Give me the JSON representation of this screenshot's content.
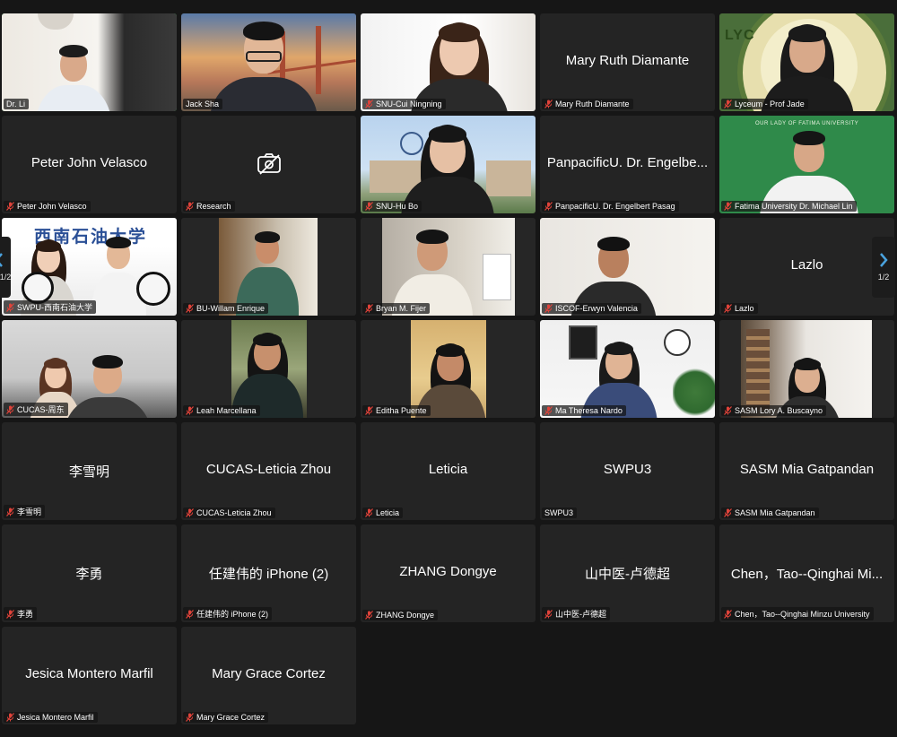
{
  "meeting": {
    "page_indicator": "1/2",
    "participants": [
      {
        "id": "dr-li",
        "name": "Dr. Li",
        "video": true,
        "active": true,
        "muted": false
      },
      {
        "id": "jack-sha",
        "name": "Jack Sha",
        "video": true,
        "muted": false
      },
      {
        "id": "snu-cui-ningning",
        "name": "SNU-Cui Ningning",
        "video": true,
        "muted": true
      },
      {
        "id": "mary-ruth-diamante",
        "name": "Mary Ruth Diamante",
        "video": false,
        "muted": true
      },
      {
        "id": "lyceum-prof-jade",
        "name": "Lyceum - Prof Jade",
        "video": true,
        "muted": true
      },
      {
        "id": "peter-john-velasco",
        "name": "Peter John Velasco",
        "video": false,
        "muted": true
      },
      {
        "id": "research",
        "name": "Research",
        "video": false,
        "camera_off_icon": true,
        "muted": true
      },
      {
        "id": "snu-hu-bo",
        "name": "SNU-Hu Bo",
        "video": true,
        "muted": true
      },
      {
        "id": "panpacific",
        "name": "PanpacificU. Dr. Engelbert Pasag",
        "display_name": "PanpacificU. Dr. Engelbe...",
        "video": false,
        "muted": true
      },
      {
        "id": "fatima",
        "name": "Fatima University Dr. Michael Lin",
        "video": true,
        "muted": true
      },
      {
        "id": "swpu",
        "name": "SWPU-西南石油大学",
        "video": true,
        "muted": true
      },
      {
        "id": "bu-willam",
        "name": "BU-Willam Enrique",
        "video": true,
        "muted": true
      },
      {
        "id": "bryan",
        "name": "Bryan M. Fijer",
        "video": true,
        "muted": true
      },
      {
        "id": "iscof",
        "name": "ISCOF-Erwyn Valencia",
        "video": true,
        "muted": true
      },
      {
        "id": "lazlo",
        "name": "Lazlo",
        "video": false,
        "muted": true
      },
      {
        "id": "cucas-zhoudong",
        "name": "CUCAS-周东",
        "video": true,
        "muted": true
      },
      {
        "id": "leah",
        "name": "Leah Marcellana",
        "video": true,
        "muted": true
      },
      {
        "id": "editha",
        "name": "Editha Puente",
        "video": true,
        "muted": true
      },
      {
        "id": "ma-theresa",
        "name": "Ma Theresa Nardo",
        "video": true,
        "muted": true
      },
      {
        "id": "sasm-lory",
        "name": "SASM Lory A. Buscayno",
        "video": true,
        "muted": true
      },
      {
        "id": "li-xueming",
        "name": "李雪明",
        "video": false,
        "muted": true
      },
      {
        "id": "cucas-leticia",
        "name": "CUCAS-Leticia Zhou",
        "video": false,
        "muted": true
      },
      {
        "id": "leticia",
        "name": "Leticia",
        "video": false,
        "muted": true
      },
      {
        "id": "swpu3",
        "name": "SWPU3",
        "video": false,
        "muted": false
      },
      {
        "id": "sasm-mia",
        "name": "SASM Mia Gatpandan",
        "video": false,
        "muted": true
      },
      {
        "id": "li-yong",
        "name": "李勇",
        "video": false,
        "muted": true
      },
      {
        "id": "ren-iphone",
        "name": "任建伟的 iPhone (2)",
        "video": false,
        "muted": true
      },
      {
        "id": "zhang-dongye",
        "name": "ZHANG Dongye",
        "video": false,
        "muted": true
      },
      {
        "id": "shanzhongyi",
        "name": "山中医-卢德超",
        "video": false,
        "muted": true
      },
      {
        "id": "chen-tao",
        "name": "Chen，Tao--Qinghai Minzu University",
        "display_name": "Chen，Tao--Qinghai Mi...",
        "video": false,
        "muted": true
      },
      {
        "id": "jesica",
        "name": "Jesica Montero Marfil",
        "video": false,
        "muted": true
      },
      {
        "id": "mary-grace",
        "name": "Mary Grace Cortez",
        "video": false,
        "muted": true
      }
    ]
  },
  "backgrounds": {
    "swpu_banner": "西南石油大学",
    "fatima_banner": "OUR LADY OF FATIMA UNIVERSITY",
    "lyceum_letters": "LYC"
  },
  "colors": {
    "background": "#161616",
    "tile": "#242424",
    "active_outline": "#37c24d",
    "muted_mic": "#e0433a",
    "page_arrow": "#4aa3df"
  },
  "icons": {
    "muted": "mic-muted-icon",
    "camera_off": "camera-off-icon",
    "prev": "chevron-left-icon",
    "next": "chevron-right-icon"
  }
}
